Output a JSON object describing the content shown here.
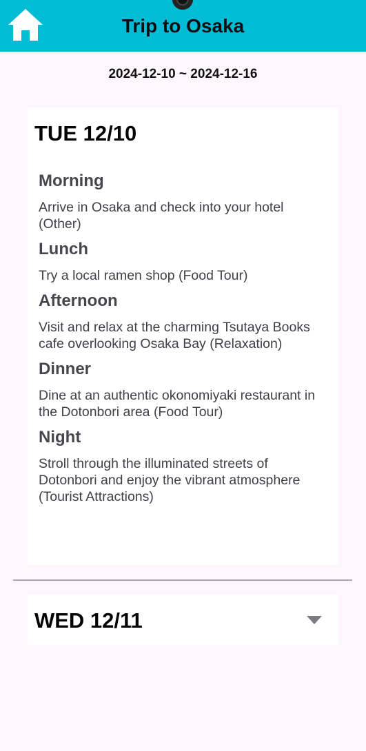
{
  "header": {
    "title": "Trip to Osaka",
    "home_icon": "home-icon",
    "color": "#00bcd4"
  },
  "trip": {
    "date_range": "2024-12-10 ~ 2024-12-16"
  },
  "days": [
    {
      "title": "TUE 12/10",
      "expanded": true,
      "slots": [
        {
          "label": "Morning",
          "desc": "Arrive in Osaka and check into your hotel (Other)"
        },
        {
          "label": "Lunch",
          "desc": "Try a local ramen shop (Food Tour)"
        },
        {
          "label": "Afternoon",
          "desc": "Visit and relax at the charming Tsutaya Books cafe overlooking Osaka Bay (Relaxation)"
        },
        {
          "label": "Dinner",
          "desc": "Dine at an authentic okonomiyaki restaurant in the Dotonbori area (Food Tour)"
        },
        {
          "label": "Night",
          "desc": "Stroll through the illuminated streets of Dotonbori and enjoy the vibrant atmosphere (Tourist Attractions)"
        }
      ]
    },
    {
      "title": "WED 12/11",
      "expanded": false,
      "icon": "chevron-down-icon"
    }
  ]
}
